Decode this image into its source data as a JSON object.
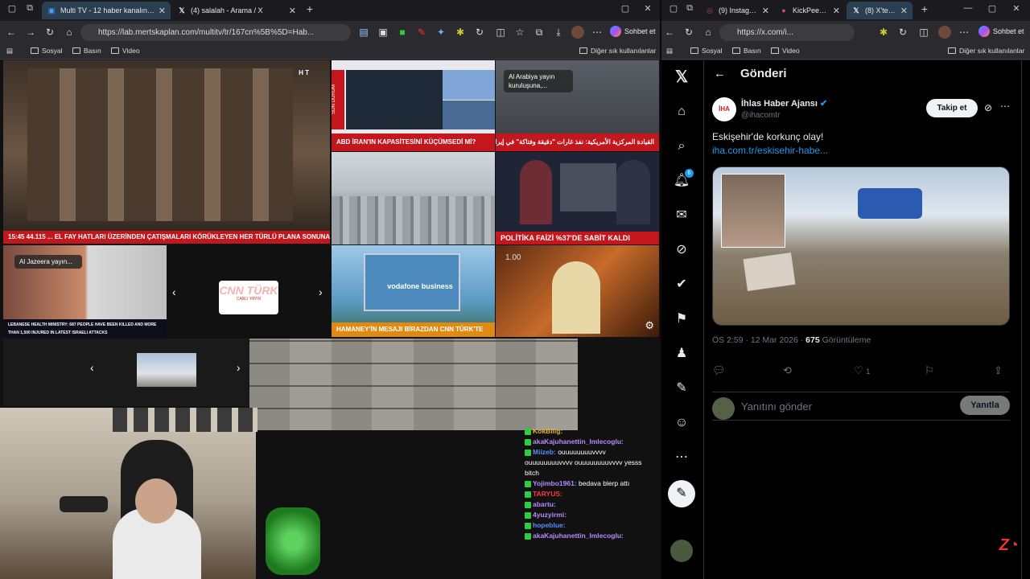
{
  "left_window": {
    "tabs": [
      {
        "label": "Multi TV - 12 haber kanalını aynı a",
        "icon": "multitv-icon"
      },
      {
        "label": "(4) salalah - Arama / X",
        "icon": "x-logo-icon"
      }
    ],
    "new_tab": "+",
    "url": "https://lab.mertskaplan.com/multitv/tr/167cn%5B%5D=Hab...",
    "sohbet": "Sohbet et",
    "bookmarks": [
      "Sosyal",
      "Basın",
      "Video"
    ],
    "bookmarks_other": "Diğer sık kullanılanlar",
    "tiles": {
      "t1_ticker": "15:45  44.115  ... EL FAY HATLARI ÜZERİNDEN ÇATIŞMALARI KÖRÜKLEYEN HER TÜRLÜ PLANA SONUNA",
      "t2_ticker": "ABD İRAN'IN KAPASİTESİNİ KÜÇÜMSEDİ Mİ?",
      "t2_side": "SON DURUM",
      "t3_label": "Al Arabiya yayın kuruluşuna,...",
      "t3_ticker": "القيادة المركزية الأمريكية: نفذ غارات \"دقيقة وفتاكة\" في إيران",
      "t5_ticker": "POLİTİKA FAİZİ %37'DE SABİT KALDI",
      "t6_label": "Al Jazeera yayın...",
      "t6_ticker": "LEBANESE HEALTH MINISTRY: 687 PEOPLE HAVE BEEN KILLED AND MORE THAN 1,500 INJURED IN LATEST ISRAELI ATTACKS",
      "t7_logo": "CNN TÜRK",
      "t7_sub": "CANLI YAYIN",
      "t8_brand": "vodafone business",
      "t8_ticker": "HAMANEY'İN MESAJI BİRAZDAN CNN TÜRK'TE",
      "t9_time": "1.00"
    },
    "chat": [
      {
        "name": "KokBilig:",
        "color": "#e6b22e",
        "msg": ""
      },
      {
        "name": "akaKajuhanettin_lmlecoglu:",
        "color": "#b58cff",
        "msg": ""
      },
      {
        "name": "Miizeb:",
        "color": "#5b8cff",
        "msg": "ouuuuuuuuvvvv ouuuuuuuuvvvv ouuuuuuuuvvvv yesss bitch"
      },
      {
        "name": "Yojimbo1961:",
        "color": "#b58cff",
        "msg": "bedava blerp attı"
      },
      {
        "name": "TARYUS:",
        "color": "#ff3b3b",
        "msg": ""
      },
      {
        "name": "abartu:",
        "color": "#b58cff",
        "msg": ""
      },
      {
        "name": "4yuzyirmi:",
        "color": "#b58cff",
        "msg": ""
      },
      {
        "name": "hopeblue:",
        "color": "#5b8cff",
        "msg": ""
      },
      {
        "name": "akaKajuhanettin_lmlecoglu:",
        "color": "#b58cff",
        "msg": ""
      }
    ]
  },
  "right_window": {
    "tabs": [
      {
        "label": "(9) Instagram",
        "icon": "instagram-icon"
      },
      {
        "label": "KickPeek - Re",
        "icon": "kickpeek-icon"
      },
      {
        "label": "(8) X'te İhlas",
        "icon": "x-logo-icon"
      }
    ],
    "url": "https://x.com/i...",
    "sohbet": "Sohbet et",
    "bookmarks": [
      "Sosyal",
      "Basın",
      "Video"
    ],
    "bookmarks_other": "Diğer sık kullanılanlar",
    "x": {
      "page_title": "Gönderi",
      "account_name": "İhlas Haber Ajansı",
      "handle": "@ihacomtr",
      "avatar_text": "İHA",
      "follow": "Takip et",
      "text": "Eskişehir'de korkunç olay!",
      "link": "iha.com.tr/eskisehir-habe...",
      "time": "ÖS 2:59 · 12 Mar 2026 · ",
      "views": "675",
      "views_label": " Görüntüleme",
      "likes": "1",
      "notifications_badge": "6",
      "reply_placeholder": "Yanıtını gönder",
      "reply_button": "Yanıtla"
    }
  },
  "colors": {
    "accent_blue": "#1d9bf0",
    "ticker_red": "#c4171d",
    "tab_active": "#2b3f53"
  }
}
